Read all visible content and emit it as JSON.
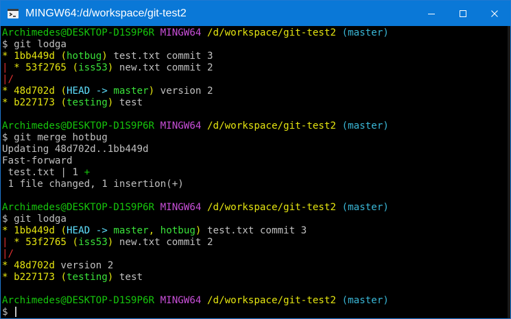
{
  "window": {
    "title": "MINGW64:/d/workspace/git-test2",
    "icons": {
      "app": "git-bash-icon",
      "minimize": "minimize-icon",
      "maximize": "maximize-icon",
      "close": "close-icon"
    }
  },
  "colors": {
    "titlebar": "#0a78d7",
    "green": "#16c60c",
    "magenta": "#c84fd8",
    "yellow": "#e5e510",
    "cyan": "#3ab8d8",
    "light_cyan": "#5fe0ff",
    "light_green": "#3ae23a",
    "red": "#e03030",
    "default": "#c0c0c0"
  },
  "terminal": {
    "lines": [
      [
        [
          "Archimedes@DESKTOP-D1S9P6R",
          "green"
        ],
        [
          " ",
          "default"
        ],
        [
          "MINGW64",
          "magenta"
        ],
        [
          " ",
          "default"
        ],
        [
          "/d/workspace/git-test2",
          "yellow"
        ],
        [
          " ",
          "default"
        ],
        [
          "(master)",
          "cyan"
        ]
      ],
      [
        [
          "$ git lodga",
          "default"
        ]
      ],
      [
        [
          "*",
          "yellow"
        ],
        [
          " ",
          "default"
        ],
        [
          "1bb449d",
          "yellow"
        ],
        [
          " ",
          "default"
        ],
        [
          "(",
          "yellow"
        ],
        [
          "hotbug",
          "light_green"
        ],
        [
          ")",
          "yellow"
        ],
        [
          " test.txt commit 3",
          "default"
        ]
      ],
      [
        [
          "|",
          "red"
        ],
        [
          " ",
          "default"
        ],
        [
          "*",
          "yellow"
        ],
        [
          " ",
          "default"
        ],
        [
          "53f2765",
          "yellow"
        ],
        [
          " ",
          "default"
        ],
        [
          "(",
          "yellow"
        ],
        [
          "iss53",
          "light_green"
        ],
        [
          ")",
          "yellow"
        ],
        [
          " new.txt commit 2",
          "default"
        ]
      ],
      [
        [
          "|/",
          "red"
        ]
      ],
      [
        [
          "*",
          "yellow"
        ],
        [
          " ",
          "default"
        ],
        [
          "48d702d",
          "yellow"
        ],
        [
          " ",
          "default"
        ],
        [
          "(",
          "yellow"
        ],
        [
          "HEAD -> ",
          "light_cyan"
        ],
        [
          "master",
          "light_green"
        ],
        [
          ")",
          "yellow"
        ],
        [
          " version 2",
          "default"
        ]
      ],
      [
        [
          "*",
          "yellow"
        ],
        [
          " ",
          "default"
        ],
        [
          "b227173",
          "yellow"
        ],
        [
          " ",
          "default"
        ],
        [
          "(",
          "yellow"
        ],
        [
          "testing",
          "light_green"
        ],
        [
          ")",
          "yellow"
        ],
        [
          " test",
          "default"
        ]
      ],
      [],
      [
        [
          "Archimedes@DESKTOP-D1S9P6R",
          "green"
        ],
        [
          " ",
          "default"
        ],
        [
          "MINGW64",
          "magenta"
        ],
        [
          " ",
          "default"
        ],
        [
          "/d/workspace/git-test2",
          "yellow"
        ],
        [
          " ",
          "default"
        ],
        [
          "(master)",
          "cyan"
        ]
      ],
      [
        [
          "$ git merge hotbug",
          "default"
        ]
      ],
      [
        [
          "Updating 48d702d..1bb449d",
          "default"
        ]
      ],
      [
        [
          "Fast-forward",
          "default"
        ]
      ],
      [
        [
          " test.txt | 1 ",
          "default"
        ],
        [
          "+",
          "green"
        ]
      ],
      [
        [
          " 1 file changed, 1 insertion(+)",
          "default"
        ]
      ],
      [],
      [
        [
          "Archimedes@DESKTOP-D1S9P6R",
          "green"
        ],
        [
          " ",
          "default"
        ],
        [
          "MINGW64",
          "magenta"
        ],
        [
          " ",
          "default"
        ],
        [
          "/d/workspace/git-test2",
          "yellow"
        ],
        [
          " ",
          "default"
        ],
        [
          "(master)",
          "cyan"
        ]
      ],
      [
        [
          "$ git lodga",
          "default"
        ]
      ],
      [
        [
          "*",
          "yellow"
        ],
        [
          " ",
          "default"
        ],
        [
          "1bb449d",
          "yellow"
        ],
        [
          " ",
          "default"
        ],
        [
          "(",
          "yellow"
        ],
        [
          "HEAD -> ",
          "light_cyan"
        ],
        [
          "master",
          "light_green"
        ],
        [
          ", ",
          "yellow"
        ],
        [
          "hotbug",
          "light_green"
        ],
        [
          ")",
          "yellow"
        ],
        [
          " test.txt commit 3",
          "default"
        ]
      ],
      [
        [
          "|",
          "red"
        ],
        [
          " ",
          "default"
        ],
        [
          "*",
          "yellow"
        ],
        [
          " ",
          "default"
        ],
        [
          "53f2765",
          "yellow"
        ],
        [
          " ",
          "default"
        ],
        [
          "(",
          "yellow"
        ],
        [
          "iss53",
          "light_green"
        ],
        [
          ")",
          "yellow"
        ],
        [
          " new.txt commit 2",
          "default"
        ]
      ],
      [
        [
          "|/",
          "red"
        ]
      ],
      [
        [
          "*",
          "yellow"
        ],
        [
          " ",
          "default"
        ],
        [
          "48d702d",
          "yellow"
        ],
        [
          " version 2",
          "default"
        ]
      ],
      [
        [
          "*",
          "yellow"
        ],
        [
          " ",
          "default"
        ],
        [
          "b227173",
          "yellow"
        ],
        [
          " ",
          "default"
        ],
        [
          "(",
          "yellow"
        ],
        [
          "testing",
          "light_green"
        ],
        [
          ")",
          "yellow"
        ],
        [
          " test",
          "default"
        ]
      ],
      [],
      [
        [
          "Archimedes@DESKTOP-D1S9P6R",
          "green"
        ],
        [
          " ",
          "default"
        ],
        [
          "MINGW64",
          "magenta"
        ],
        [
          " ",
          "default"
        ],
        [
          "/d/workspace/git-test2",
          "yellow"
        ],
        [
          " ",
          "default"
        ],
        [
          "(master)",
          "cyan"
        ]
      ],
      [
        [
          "$ ",
          "default"
        ]
      ]
    ]
  }
}
